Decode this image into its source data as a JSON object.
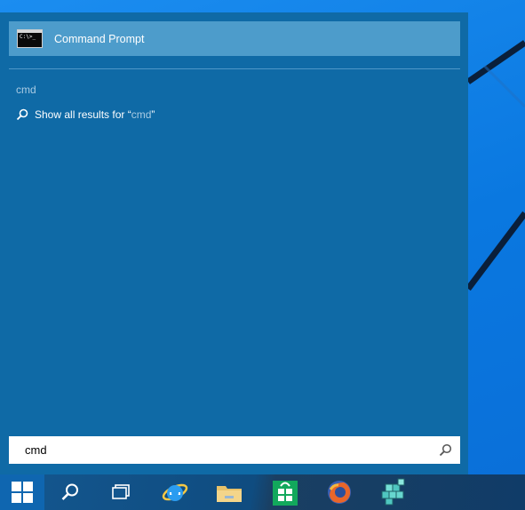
{
  "results": {
    "top_match": {
      "label": "Command Prompt",
      "icon": "command-prompt-icon",
      "icon_text": "C:\\>_"
    },
    "group_header": "cmd",
    "show_all": {
      "prefix": "Show all results for “",
      "term": "cmd",
      "suffix": "”",
      "icon": "search-icon"
    }
  },
  "search": {
    "value": "cmd",
    "icon": "search-icon"
  },
  "taskbar": {
    "items": [
      {
        "name": "start",
        "icon": "windows-logo-icon"
      },
      {
        "name": "search",
        "icon": "search-icon"
      },
      {
        "name": "task-view",
        "icon": "task-view-icon"
      },
      {
        "name": "internet-explorer",
        "icon": "internet-explorer-icon"
      },
      {
        "name": "file-explorer",
        "icon": "folder-icon"
      },
      {
        "name": "store",
        "icon": "store-icon"
      },
      {
        "name": "firefox",
        "icon": "firefox-icon"
      },
      {
        "name": "app",
        "icon": "cubes-icon"
      }
    ]
  },
  "colors": {
    "panel": "#0f6aa6",
    "highlight": "#4d9ccb",
    "desktop": "#0e7ee8",
    "taskbar": "#0c3f6e"
  }
}
